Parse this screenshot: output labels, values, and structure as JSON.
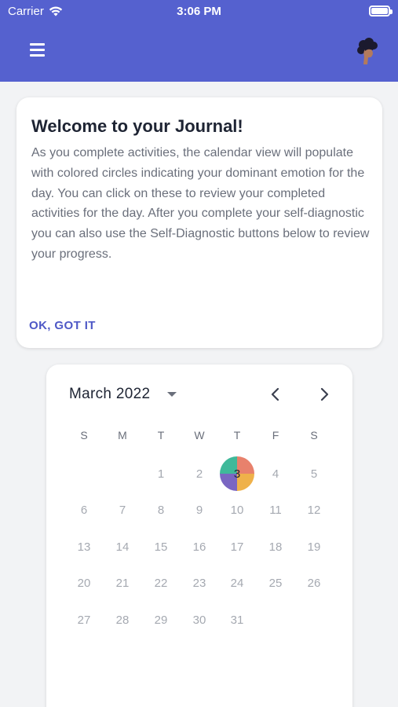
{
  "status_bar": {
    "carrier": "Carrier",
    "time": "3:06 PM"
  },
  "header": {
    "menu_icon": "hamburger-menu-icon",
    "avatar_icon": "user-avatar-icon"
  },
  "welcome": {
    "title": "Welcome to your Journal!",
    "body": "As you complete activities, the calendar view will populate with colored circles indicating your dominant emotion for the day. You can click on these to review your completed activities for the day. After you complete your self-diagnostic you can also use the Self-Diagnostic buttons below to review your progress.",
    "button": "OK, GOT IT"
  },
  "calendar": {
    "month_label": "March 2022",
    "weekdays": [
      "S",
      "M",
      "T",
      "W",
      "T",
      "F",
      "S"
    ],
    "first_weekday": 2,
    "days_in_month": 31,
    "highlighted_day": 3,
    "emotion_colors": [
      "#e8816c",
      "#efb14a",
      "#7a66c2",
      "#3fb99a"
    ]
  }
}
